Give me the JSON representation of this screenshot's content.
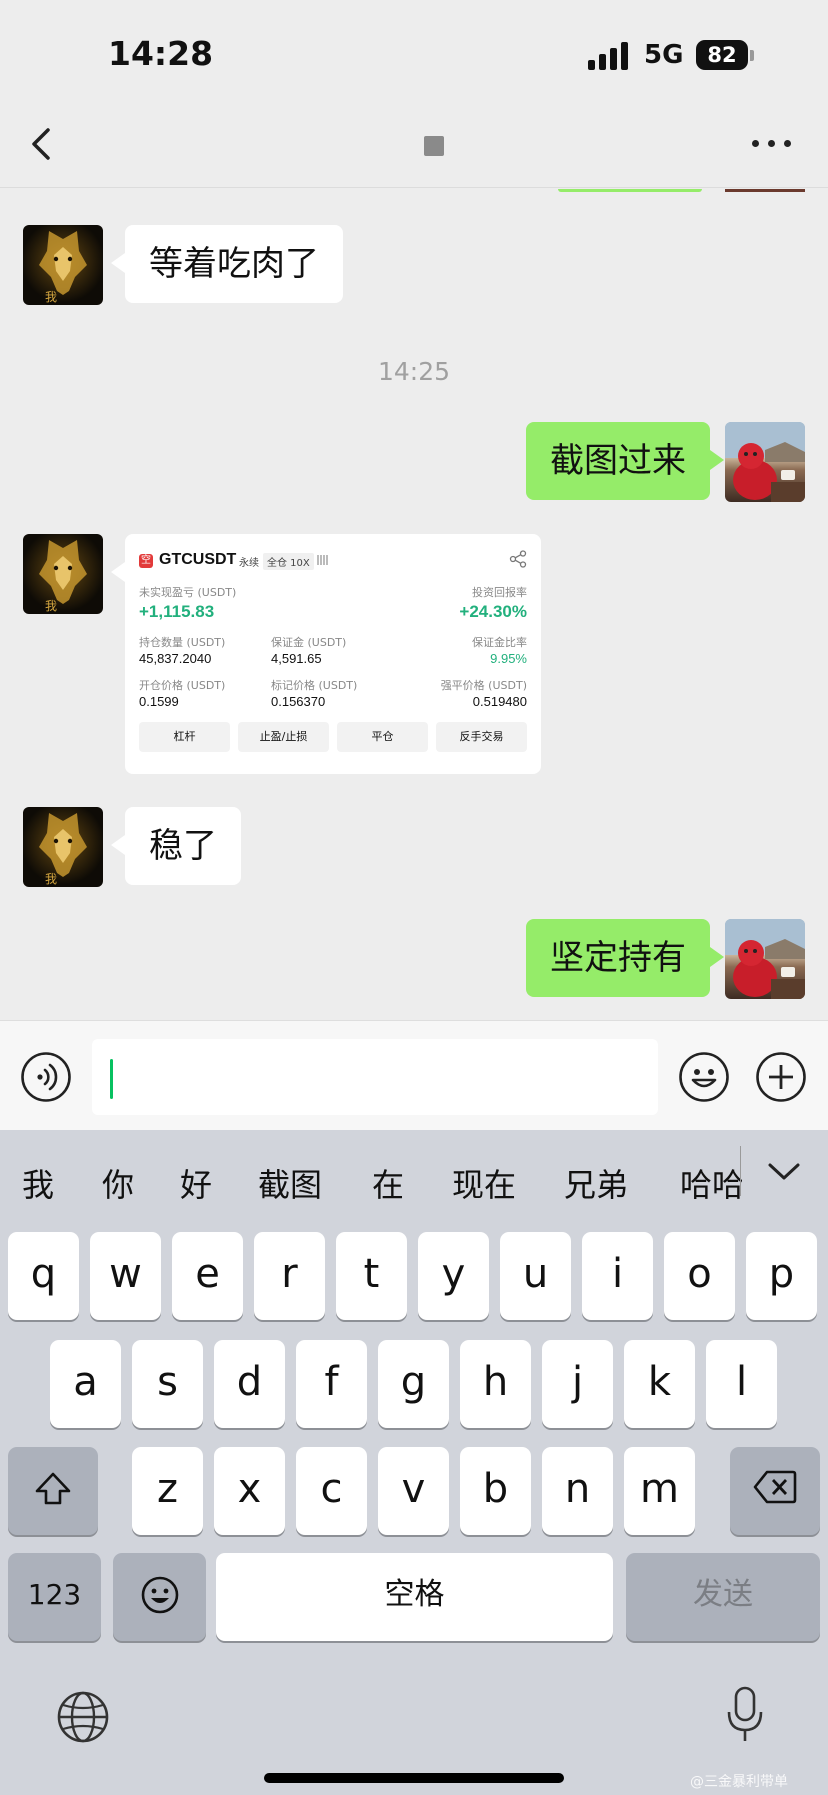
{
  "status_bar": {
    "time": "14:28",
    "network": "5G",
    "battery": "82"
  },
  "nav": {
    "title": ""
  },
  "messages": [
    {
      "side": "in",
      "text": "等着吃肉了"
    },
    {
      "timestamp": "14:25"
    },
    {
      "side": "out",
      "text": "截图过来"
    },
    {
      "side": "in",
      "type": "trade-card"
    },
    {
      "side": "in",
      "text": "稳了"
    },
    {
      "side": "out",
      "text": "坚定持有"
    }
  ],
  "trade_card": {
    "pair": "GTCUSDT",
    "logo": "空",
    "tags": [
      "永续",
      "全仓 10X"
    ],
    "unrealized_pnl_label": "未实现盈亏 (USDT)",
    "unrealized_pnl": "+1,115.83",
    "roi_label": "投资回报率",
    "roi": "+24.30%",
    "position_qty_label": "持仓数量 (USDT)",
    "position_qty": "45,837.2040",
    "margin_label": "保证金 (USDT)",
    "margin": "4,591.65",
    "margin_ratio_label": "保证金比率",
    "margin_ratio": "9.95%",
    "entry_price_label": "开仓价格 (USDT)",
    "entry_price": "0.1599",
    "mark_price_label": "标记价格 (USDT)",
    "mark_price": "0.156370",
    "liq_price_label": "强平价格 (USDT)",
    "liq_price": "0.519480",
    "buttons": [
      "杠杆",
      "止盈/止损",
      "平仓",
      "反手交易"
    ]
  },
  "input": {
    "value": ""
  },
  "keyboard": {
    "suggestions": [
      "我",
      "你",
      "好",
      "截图",
      "在",
      "现在",
      "兄弟",
      "哈哈"
    ],
    "row1": [
      "q",
      "w",
      "e",
      "r",
      "t",
      "y",
      "u",
      "i",
      "o",
      "p"
    ],
    "row2": [
      "a",
      "s",
      "d",
      "f",
      "g",
      "h",
      "j",
      "k",
      "l"
    ],
    "row3": [
      "z",
      "x",
      "c",
      "v",
      "b",
      "n",
      "m"
    ],
    "numbers_label": "123",
    "space_label": "空格",
    "send_label": "发送"
  },
  "watermark": "@三金暴利带单",
  "icons": [
    "back-icon",
    "more-icon",
    "share-icon",
    "voice-icon",
    "emoji-icon",
    "plus-icon",
    "collapse-icon",
    "shift-icon",
    "backspace-icon",
    "emoji-key-icon",
    "globe-icon",
    "mic-icon"
  ],
  "colors": {
    "sent_bubble": "#95ec69",
    "received_bubble": "#ffffff",
    "chat_bg": "#ededed",
    "profit_green": "#22b07d",
    "keyboard_bg": "#d1d4db"
  }
}
